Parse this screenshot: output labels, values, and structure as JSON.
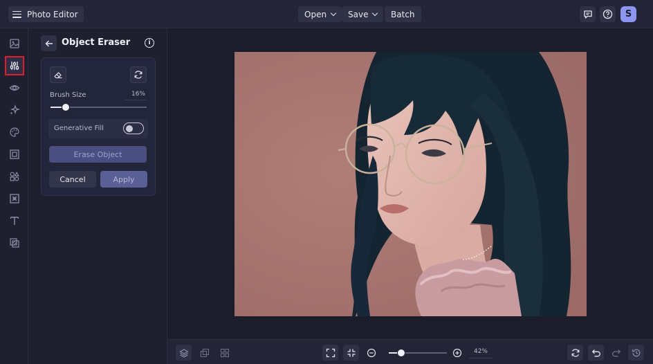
{
  "app": {
    "title": "Photo Editor"
  },
  "topbar": {
    "open_label": "Open",
    "save_label": "Save",
    "batch_label": "Batch",
    "avatar_initial": "S"
  },
  "rail": {
    "items": [
      {
        "icon": "image-icon",
        "active": false
      },
      {
        "icon": "sliders-icon",
        "active": true
      },
      {
        "icon": "eye-icon",
        "active": false
      },
      {
        "icon": "magic-sparkle-icon",
        "active": false
      },
      {
        "icon": "palette-icon",
        "active": false
      },
      {
        "icon": "frame-icon",
        "active": false
      },
      {
        "icon": "shapes-icon",
        "active": false
      },
      {
        "icon": "texture-icon",
        "active": false
      },
      {
        "icon": "text-icon",
        "active": false
      },
      {
        "icon": "overlay-icon",
        "active": false
      }
    ]
  },
  "panel": {
    "title": "Object Eraser",
    "brush_size_label": "Brush Size",
    "brush_size_value": "16%",
    "brush_size_fraction": 0.16,
    "generative_fill_label": "Generative Fill",
    "generative_fill_on": false,
    "erase_label": "Erase Object",
    "cancel_label": "Cancel",
    "apply_label": "Apply"
  },
  "bottombar": {
    "zoom_value": "42%",
    "zoom_fraction": 0.42
  },
  "colors": {
    "accent": "#8c96f0",
    "active_outline": "#e01e2b",
    "apply": "#5a5f96"
  }
}
